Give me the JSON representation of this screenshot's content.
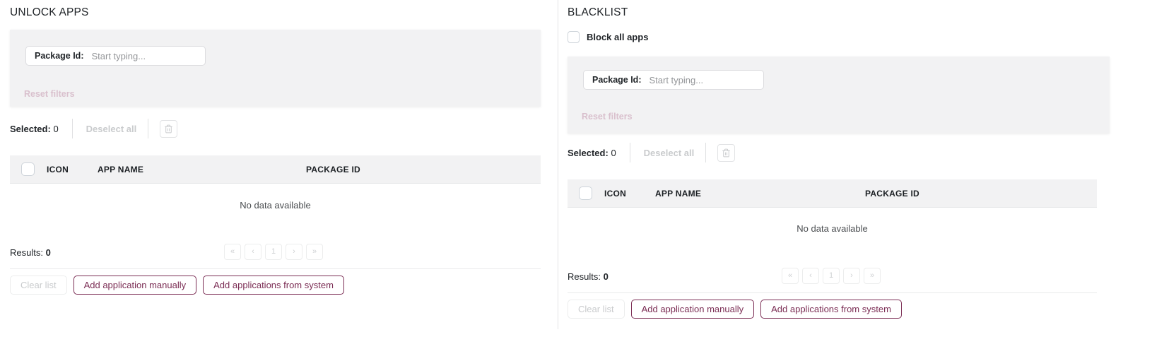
{
  "theme": {
    "accent": "#7b2d54",
    "muted": "#c9cbcd",
    "reset_link": "#d9c0cd",
    "panel_bg": "#f2f2f3"
  },
  "left_panel": {
    "title": "UNLOCK APPS",
    "filter": {
      "package_id_label": "Package Id:",
      "package_id_value": "",
      "package_id_placeholder": "Start typing...",
      "reset_filters_label": "Reset filters"
    },
    "toolbar": {
      "selected_label": "Selected:",
      "selected_count": "0",
      "deselect_all_label": "Deselect all",
      "delete_icon": "trash-icon"
    },
    "table": {
      "columns": [
        "ICON",
        "APP NAME",
        "PACKAGE ID"
      ],
      "rows": [],
      "empty_message": "No data available"
    },
    "results": {
      "label": "Results:",
      "count": "0"
    },
    "pagination": {
      "first": "«",
      "prev": "‹",
      "current_page": "1",
      "next": "›",
      "last": "»"
    },
    "footer": {
      "clear_list_label": "Clear list",
      "add_manually_label": "Add application manually",
      "add_from_system_label": "Add applications from system"
    }
  },
  "right_panel": {
    "title": "BLACKLIST",
    "block_all": {
      "label": "Block all apps",
      "checked": false
    },
    "filter": {
      "package_id_label": "Package Id:",
      "package_id_value": "",
      "package_id_placeholder": "Start typing...",
      "reset_filters_label": "Reset filters"
    },
    "toolbar": {
      "selected_label": "Selected:",
      "selected_count": "0",
      "deselect_all_label": "Deselect all",
      "delete_icon": "trash-icon"
    },
    "table": {
      "columns": [
        "ICON",
        "APP NAME",
        "PACKAGE ID"
      ],
      "rows": [],
      "empty_message": "No data available"
    },
    "results": {
      "label": "Results:",
      "count": "0"
    },
    "pagination": {
      "first": "«",
      "prev": "‹",
      "current_page": "1",
      "next": "›",
      "last": "»"
    },
    "footer": {
      "clear_list_label": "Clear list",
      "add_manually_label": "Add application manually",
      "add_from_system_label": "Add applications from system"
    }
  }
}
